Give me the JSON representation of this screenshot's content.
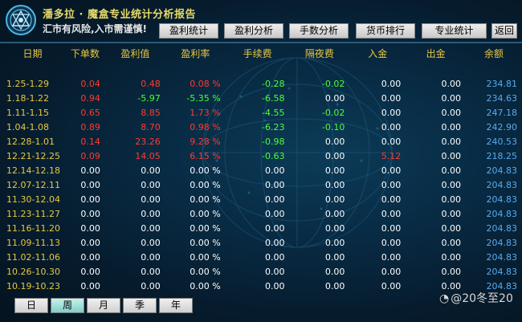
{
  "header": {
    "title": "潘多拉 · 魔盒专业统计分析报告",
    "subtitle": "汇市有风险,入市需谨慎!"
  },
  "tabs": [
    {
      "label": "盈利统计"
    },
    {
      "label": "盈利分析"
    },
    {
      "label": "手数分析"
    },
    {
      "label": "货币排行"
    },
    {
      "label": "专业统计"
    },
    {
      "label": "返回"
    }
  ],
  "columns": [
    "日期",
    "下单数",
    "盈利值",
    "盈利率",
    "手续费",
    "隔夜费",
    "入金",
    "出金",
    "余额"
  ],
  "rows": [
    {
      "date": "1.25-1.29",
      "orders": "0.04",
      "profit": "0.48",
      "rate": "0.08 %",
      "fee": "-0.28",
      "overnight": "-0.02",
      "deposit": "0.00",
      "withdraw": "0.00",
      "balance": "234.81",
      "orders_c": "red",
      "profit_c": "red",
      "rate_c": "red",
      "fee_c": "green",
      "overnight_c": "green",
      "deposit_c": "white"
    },
    {
      "date": "1.18-1.22",
      "orders": "0.94",
      "profit": "-5.97",
      "rate": "-5.35 %",
      "fee": "-6.58",
      "overnight": "0.00",
      "deposit": "0.00",
      "withdraw": "0.00",
      "balance": "234.63",
      "orders_c": "red",
      "profit_c": "green",
      "rate_c": "green",
      "fee_c": "green",
      "overnight_c": "white",
      "deposit_c": "white"
    },
    {
      "date": "1.11-1.15",
      "orders": "0.65",
      "profit": "8.85",
      "rate": "1.73 %",
      "fee": "-4.55",
      "overnight": "-0.02",
      "deposit": "0.00",
      "withdraw": "0.00",
      "balance": "247.18",
      "orders_c": "red",
      "profit_c": "red",
      "rate_c": "red",
      "fee_c": "green",
      "overnight_c": "green",
      "deposit_c": "white"
    },
    {
      "date": "1.04-1.08",
      "orders": "0.89",
      "profit": "8.70",
      "rate": "0.98 %",
      "fee": "-6.23",
      "overnight": "-0.10",
      "deposit": "0.00",
      "withdraw": "0.00",
      "balance": "242.90",
      "orders_c": "red",
      "profit_c": "red",
      "rate_c": "red",
      "fee_c": "green",
      "overnight_c": "green",
      "deposit_c": "white"
    },
    {
      "date": "12.28-1.01",
      "orders": "0.14",
      "profit": "23.26",
      "rate": "9.28 %",
      "fee": "-0.98",
      "overnight": "0.00",
      "deposit": "0.00",
      "withdraw": "0.00",
      "balance": "240.53",
      "orders_c": "red",
      "profit_c": "red",
      "rate_c": "red",
      "fee_c": "green",
      "overnight_c": "white",
      "deposit_c": "white"
    },
    {
      "date": "12.21-12.25",
      "orders": "0.09",
      "profit": "14.05",
      "rate": "6.15 %",
      "fee": "-0.63",
      "overnight": "0.00",
      "deposit": "5.12",
      "withdraw": "0.00",
      "balance": "218.25",
      "orders_c": "red",
      "profit_c": "red",
      "rate_c": "red",
      "fee_c": "green",
      "overnight_c": "white",
      "deposit_c": "red"
    },
    {
      "date": "12.14-12.18",
      "orders": "0.00",
      "profit": "0.00",
      "rate": "0.00 %",
      "fee": "0.00",
      "overnight": "0.00",
      "deposit": "0.00",
      "withdraw": "0.00",
      "balance": "204.83",
      "orders_c": "white",
      "profit_c": "white",
      "rate_c": "white",
      "fee_c": "white",
      "overnight_c": "white",
      "deposit_c": "white"
    },
    {
      "date": "12.07-12.11",
      "orders": "0.00",
      "profit": "0.00",
      "rate": "0.00 %",
      "fee": "0.00",
      "overnight": "0.00",
      "deposit": "0.00",
      "withdraw": "0.00",
      "balance": "204.83",
      "orders_c": "white",
      "profit_c": "white",
      "rate_c": "white",
      "fee_c": "white",
      "overnight_c": "white",
      "deposit_c": "white"
    },
    {
      "date": "11.30-12.04",
      "orders": "0.00",
      "profit": "0.00",
      "rate": "0.00 %",
      "fee": "0.00",
      "overnight": "0.00",
      "deposit": "0.00",
      "withdraw": "0.00",
      "balance": "204.83",
      "orders_c": "white",
      "profit_c": "white",
      "rate_c": "white",
      "fee_c": "white",
      "overnight_c": "white",
      "deposit_c": "white"
    },
    {
      "date": "11.23-11.27",
      "orders": "0.00",
      "profit": "0.00",
      "rate": "0.00 %",
      "fee": "0.00",
      "overnight": "0.00",
      "deposit": "0.00",
      "withdraw": "0.00",
      "balance": "204.83",
      "orders_c": "white",
      "profit_c": "white",
      "rate_c": "white",
      "fee_c": "white",
      "overnight_c": "white",
      "deposit_c": "white"
    },
    {
      "date": "11.16-11.20",
      "orders": "0.00",
      "profit": "0.00",
      "rate": "0.00 %",
      "fee": "0.00",
      "overnight": "0.00",
      "deposit": "0.00",
      "withdraw": "0.00",
      "balance": "204.83",
      "orders_c": "white",
      "profit_c": "white",
      "rate_c": "white",
      "fee_c": "white",
      "overnight_c": "white",
      "deposit_c": "white"
    },
    {
      "date": "11.09-11.13",
      "orders": "0.00",
      "profit": "0.00",
      "rate": "0.00 %",
      "fee": "0.00",
      "overnight": "0.00",
      "deposit": "0.00",
      "withdraw": "0.00",
      "balance": "204.83",
      "orders_c": "white",
      "profit_c": "white",
      "rate_c": "white",
      "fee_c": "white",
      "overnight_c": "white",
      "deposit_c": "white"
    },
    {
      "date": "11.02-11.06",
      "orders": "0.00",
      "profit": "0.00",
      "rate": "0.00 %",
      "fee": "0.00",
      "overnight": "0.00",
      "deposit": "0.00",
      "withdraw": "0.00",
      "balance": "204.83",
      "orders_c": "white",
      "profit_c": "white",
      "rate_c": "white",
      "fee_c": "white",
      "overnight_c": "white",
      "deposit_c": "white"
    },
    {
      "date": "10.26-10.30",
      "orders": "0.00",
      "profit": "0.00",
      "rate": "0.00 %",
      "fee": "0.00",
      "overnight": "0.00",
      "deposit": "0.00",
      "withdraw": "0.00",
      "balance": "204.83",
      "orders_c": "white",
      "profit_c": "white",
      "rate_c": "white",
      "fee_c": "white",
      "overnight_c": "white",
      "deposit_c": "white"
    },
    {
      "date": "10.19-10.23",
      "orders": "0.00",
      "profit": "0.00",
      "rate": "0.00 %",
      "fee": "0.00",
      "overnight": "0.00",
      "deposit": "0.00",
      "withdraw": "0.00",
      "balance": "204.83",
      "orders_c": "white",
      "profit_c": "white",
      "rate_c": "white",
      "fee_c": "white",
      "overnight_c": "white",
      "deposit_c": "white"
    }
  ],
  "period_tabs": [
    {
      "label": "日",
      "active": false
    },
    {
      "label": "周",
      "active": true
    },
    {
      "label": "月",
      "active": false
    },
    {
      "label": "季",
      "active": false
    },
    {
      "label": "年",
      "active": false
    }
  ],
  "watermark": {
    "icon": "weibo-icon",
    "text": "@20冬至20"
  },
  "colors": {
    "gold": "#e8c840",
    "red": "#ff3b30",
    "green": "#4cff3a",
    "white": "#ffffff",
    "balance_blue": "#5aaaf0",
    "background": "#061b2c",
    "active_tab": "#7fd0c8"
  }
}
